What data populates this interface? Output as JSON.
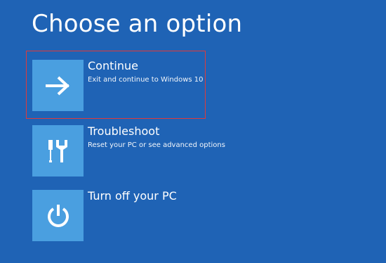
{
  "page": {
    "title": "Choose an option",
    "background_color": "#1f63b5",
    "tile_color": "#4a9fe0",
    "highlight_color": "#e03a3a"
  },
  "options": [
    {
      "label": "Continue",
      "description": "Exit and continue to Windows 10",
      "icon": "arrow-right-icon",
      "highlighted": true
    },
    {
      "label": "Troubleshoot",
      "description": "Reset your PC or see advanced options",
      "icon": "tools-icon",
      "highlighted": false
    },
    {
      "label": "Turn off your PC",
      "description": "",
      "icon": "power-icon",
      "highlighted": false
    }
  ]
}
